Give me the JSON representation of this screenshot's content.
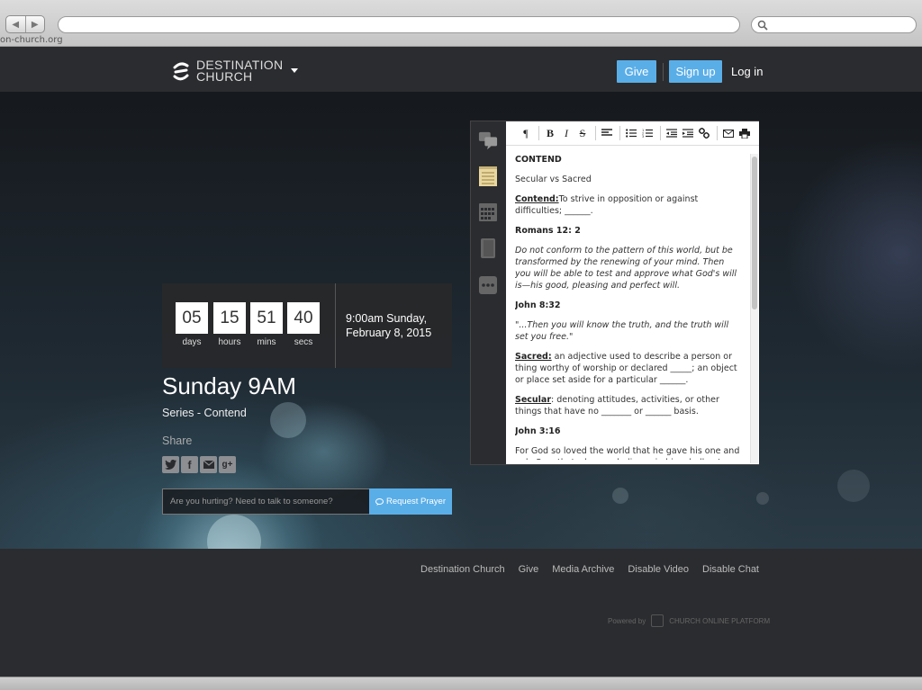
{
  "browser": {
    "url_fragment": "on-church.org"
  },
  "header": {
    "logo_line1": "DESTINATION",
    "logo_line2": "CHURCH",
    "give_label": "Give",
    "signup_label": "Sign up",
    "login_label": "Log in"
  },
  "countdown": {
    "days": "05",
    "days_label": "days",
    "hours": "15",
    "hours_label": "hours",
    "mins": "51",
    "mins_label": "mins",
    "secs": "40",
    "secs_label": "secs",
    "date_line1": "9:00am Sunday,",
    "date_line2": "February 8, 2015"
  },
  "service": {
    "title": "Sunday 9AM",
    "series": "Series - Contend",
    "share_label": "Share"
  },
  "prayer": {
    "placeholder": "Are you hurting? Need to talk to someone?",
    "button_label": "Request Prayer"
  },
  "notes": {
    "heading": "CONTEND",
    "subtitle": "Secular vs Sacred",
    "contend_term": "Contend:",
    "contend_def": "To strive in opposition or against difficulties; ______.",
    "ref1": "Romans 12: 2",
    "verse1": "Do not conform to the pattern of this world, but be transformed by the renewing of your mind. Then you will be able to test and approve what God's will is—his good, pleasing and perfect will.",
    "ref2": "John 8:32",
    "verse2": "\"...Then you will know the truth, and the truth will set you free.\"",
    "sacred_term": "Sacred:",
    "sacred_def": " an adjective used to describe a person or thing worthy of worship or declared _____; an object or place set aside for a particular ______.",
    "secular_term": "Secular",
    "secular_def": ": denoting attitudes, activities, or other things that have no _______ or ______ basis.",
    "ref3": "John 3:16",
    "verse3": "For God so loved the world that he gave his one and only Son, that whoever believes in him shall not perish"
  },
  "footer": {
    "links": [
      "Destination Church",
      "Give",
      "Media Archive",
      "Disable Video",
      "Disable Chat"
    ],
    "powered_by": "Powered by",
    "platform": "CHURCH ONLINE PLATFORM"
  },
  "colors": {
    "accent": "#5aaee8",
    "header_bg": "#2b2c2f"
  }
}
